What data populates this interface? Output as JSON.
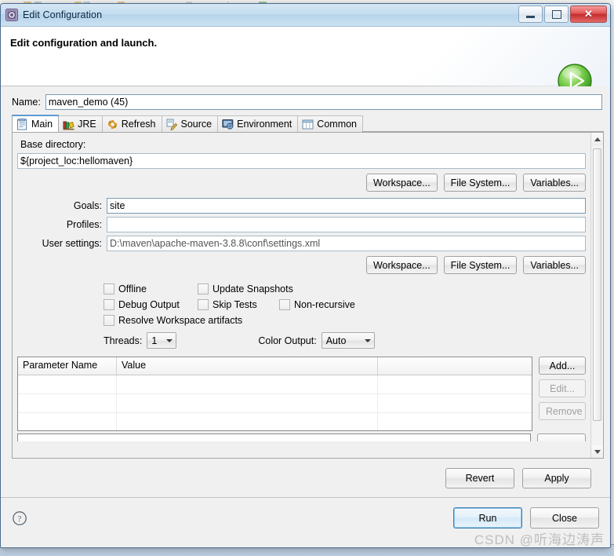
{
  "window": {
    "title": "Edit Configuration",
    "icon": "eclipse-config-icon",
    "minimize_label": "Minimize",
    "maximize_label": "Maximize",
    "close_label": "Close"
  },
  "header": {
    "title": "Edit configuration and launch.",
    "run_badge_icon": "run-play-icon"
  },
  "name_field": {
    "label": "Name:",
    "value": "maven_demo (45)",
    "placeholder": ""
  },
  "tabs": [
    {
      "label": "Main",
      "icon": "main-tab-icon",
      "active": true
    },
    {
      "label": "JRE",
      "icon": "jre-tab-icon",
      "active": false
    },
    {
      "label": "Refresh",
      "icon": "refresh-tab-icon",
      "active": false
    },
    {
      "label": "Source",
      "icon": "source-tab-icon",
      "active": false
    },
    {
      "label": "Environment",
      "icon": "environment-tab-icon",
      "active": false
    },
    {
      "label": "Common",
      "icon": "common-tab-icon",
      "active": false
    }
  ],
  "main_tab": {
    "base_directory": {
      "label": "Base directory:",
      "value": "${project_loc:hellomaven}",
      "buttons": [
        "Workspace...",
        "File System...",
        "Variables..."
      ]
    },
    "goals": {
      "label": "Goals:",
      "value": "site"
    },
    "profiles": {
      "label": "Profiles:",
      "value": ""
    },
    "user_settings": {
      "label": "User settings:",
      "value": "D:\\maven\\apache-maven-3.8.8\\conf\\settings.xml",
      "buttons": [
        "Workspace...",
        "File System...",
        "Variables..."
      ]
    },
    "checkboxes": [
      {
        "label": "Offline",
        "checked": false
      },
      {
        "label": "Update Snapshots",
        "checked": false
      },
      {
        "label": "Debug Output",
        "checked": false
      },
      {
        "label": "Skip Tests",
        "checked": false
      },
      {
        "label": "Non-recursive",
        "checked": false
      },
      {
        "label": "Resolve Workspace artifacts",
        "checked": false
      }
    ],
    "threads": {
      "label": "Threads:",
      "value": "1"
    },
    "color_output": {
      "label": "Color Output:",
      "value": "Auto"
    },
    "parameters_table": {
      "columns": [
        "Parameter Name",
        "Value",
        ""
      ],
      "rows": [
        [
          "",
          "",
          ""
        ],
        [
          "",
          "",
          ""
        ],
        [
          "",
          "",
          ""
        ]
      ]
    },
    "table_buttons": [
      {
        "label": "Add...",
        "enabled": true
      },
      {
        "label": "Edit...",
        "enabled": false
      },
      {
        "label": "Remove",
        "enabled": false
      }
    ]
  },
  "apply_bar": {
    "revert": "Revert",
    "apply": "Apply"
  },
  "footer": {
    "help_icon": "help-question-icon",
    "run": "Run",
    "close": "Close"
  },
  "watermark": "CSDN @听海边涛声",
  "colors": {
    "accent": "#3c7fb1",
    "title_bar": "#c3dcef",
    "close_button": "#c42c2c",
    "run_badge": "#5bbf3a",
    "active_tab_underline": "#5b9bd5"
  }
}
